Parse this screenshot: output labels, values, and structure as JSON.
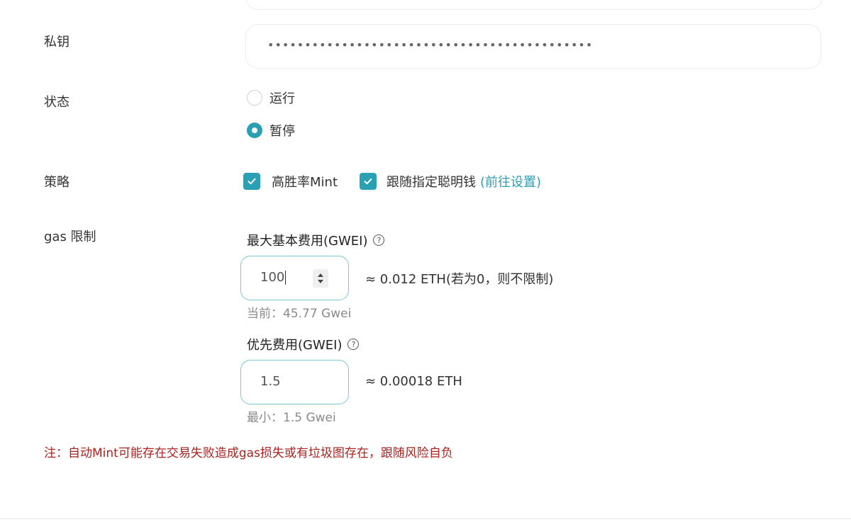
{
  "private_key": {
    "label": "私钥",
    "masked_value": "••••••••••••••••••••••••••••••••••••••••••••"
  },
  "status": {
    "label": "状态",
    "options": [
      {
        "label": "运行",
        "checked": false
      },
      {
        "label": "暂停",
        "checked": true
      }
    ]
  },
  "strategy": {
    "label": "策略",
    "options": [
      {
        "label": "高胜率Mint",
        "checked": true
      },
      {
        "label": "跟随指定聪明钱",
        "checked": true,
        "link": "(前往设置)"
      }
    ]
  },
  "gas_limit": {
    "label": "gas 限制",
    "max_base_fee": {
      "title": "最大基本费用(GWEI)",
      "help_icon": "?",
      "value": "100",
      "approx": "≈ 0.012 ETH(若为0，则不限制)",
      "hint": "当前：45.77 Gwei"
    },
    "priority_fee": {
      "title": "优先费用(GWEI)",
      "help_icon": "?",
      "value": "1.5",
      "approx": "≈ 0.00018 ETH",
      "hint": "最小：1.5 Gwei"
    }
  },
  "note": "注：自动Mint可能存在交易失败造成gas损失或有垃圾图存在，跟随风险自负",
  "colors": {
    "accent": "#2aa0b4",
    "warning": "#a8231f",
    "input_border_focus": "#7cc7d2"
  }
}
